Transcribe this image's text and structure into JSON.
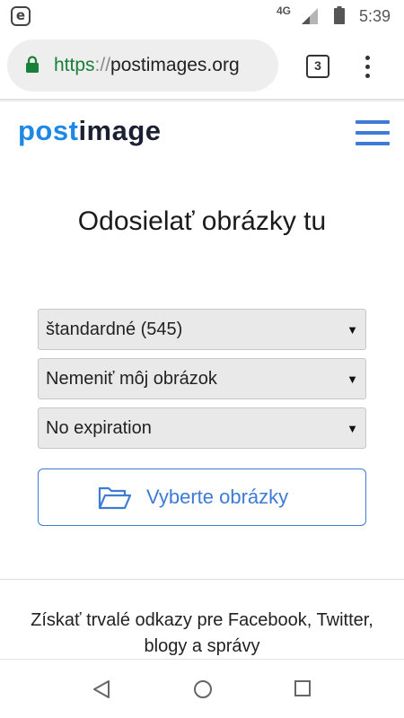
{
  "status_bar": {
    "network": "4G",
    "time": "5:39",
    "app_icon_letter": "e"
  },
  "browser": {
    "url_scheme": "https",
    "url_separator": "://",
    "url_host": "postimages.org",
    "tab_count": "3"
  },
  "site": {
    "logo_part1": "post",
    "logo_part2": "image"
  },
  "main": {
    "title": "Odosielať obrázky tu",
    "selects": [
      {
        "value": "štandardné (545)"
      },
      {
        "value": "Nemeniť môj obrázok"
      },
      {
        "value": "No expiration"
      }
    ],
    "choose_button_label": "Vyberte obrázky",
    "promo_line1": "Získať trvalé odkazy pre Facebook, Twitter,",
    "promo_line2": "blogy a správy"
  },
  "colors": {
    "accent": "#3d7bd6",
    "logo_blue": "#1e88e5",
    "logo_dark": "#1c2033",
    "secure_green": "#188038"
  },
  "icons": {
    "lock": "lock-icon",
    "folder": "folder-open-icon",
    "menu": "hamburger-menu-icon",
    "dots": "more-vert-icon",
    "nav": [
      "back-icon",
      "home-icon",
      "recents-icon"
    ]
  }
}
